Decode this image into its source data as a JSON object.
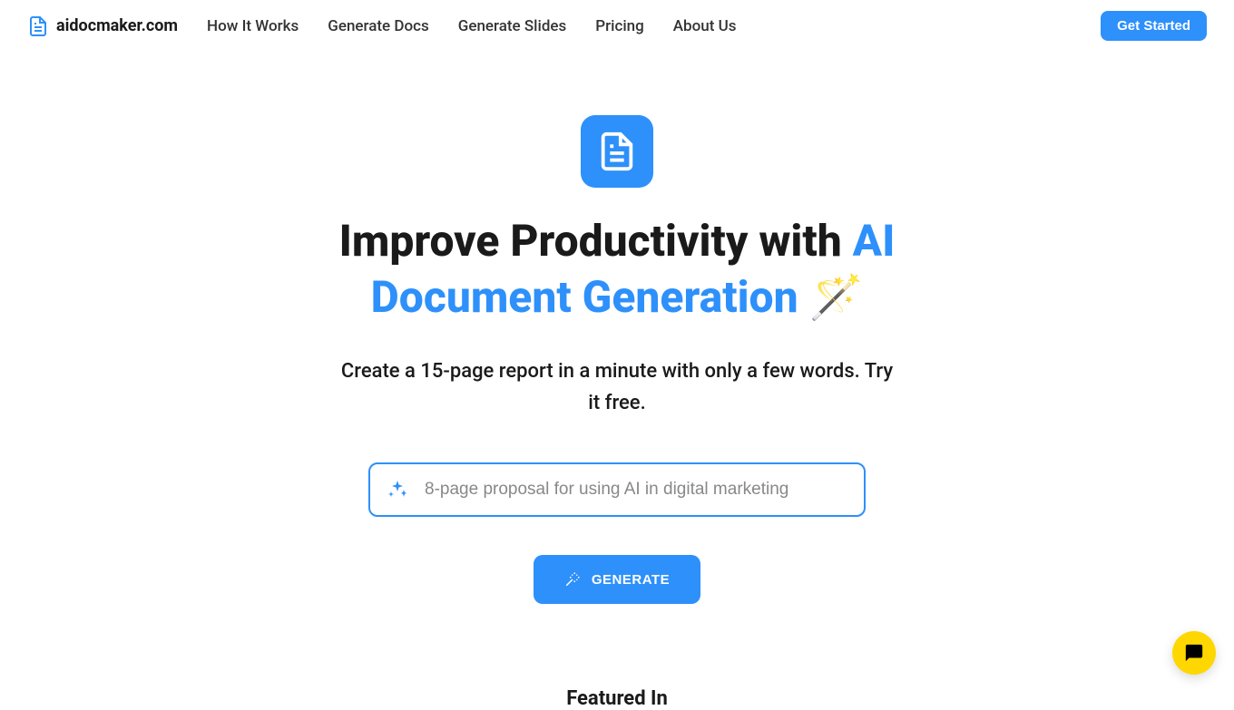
{
  "brand": {
    "name": "aidocmaker.com"
  },
  "nav": {
    "items": [
      "How It Works",
      "Generate Docs",
      "Generate Slides",
      "Pricing",
      "About Us"
    ],
    "cta": "Get Started"
  },
  "hero": {
    "title_prefix": "Improve Productivity with ",
    "title_accent": "AI Document Generation 🪄",
    "subtitle": "Create a 15-page report in a minute with only a few words. Try it free.",
    "input_placeholder": "8-page proposal for using AI in digital marketing",
    "generate_label": "GENERATE"
  },
  "featured": {
    "heading": "Featured In"
  },
  "colors": {
    "primary": "#2e90fa",
    "chat_bg": "#ffd700"
  }
}
